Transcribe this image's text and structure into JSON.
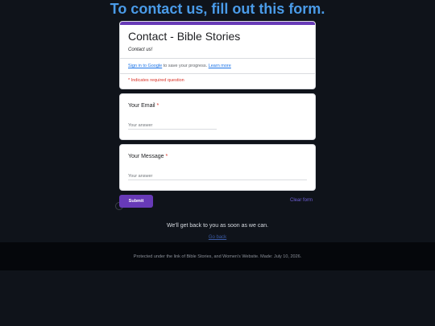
{
  "page": {
    "heading": "To contact us, fill out this form."
  },
  "form": {
    "title": "Contact - Bible Stories",
    "description": "Contact us!",
    "signin_link": "Sign in to Google",
    "signin_suffix": " to save your progress. ",
    "learn_more": "Learn more",
    "required_note": "* Indicates required question",
    "questions": [
      {
        "label": "Your Email",
        "required_mark": "*",
        "placeholder": "Your answer"
      },
      {
        "label": "Your Message",
        "required_mark": "*",
        "placeholder": "Your answer"
      }
    ],
    "submit_label": "Submit",
    "clear_label": "Clear form"
  },
  "after_form": {
    "reply_text": "We'll get back to you as soon as we can.",
    "go_back_link": "Go back"
  },
  "footer": {
    "text": "Protected under the link of Bible Stories, and Women's Website. Made: July 10, 2026."
  },
  "colors": {
    "heading": "#4a9be8",
    "form_accent": "#673ab7",
    "required": "#d93025",
    "background": "#0f131a"
  }
}
